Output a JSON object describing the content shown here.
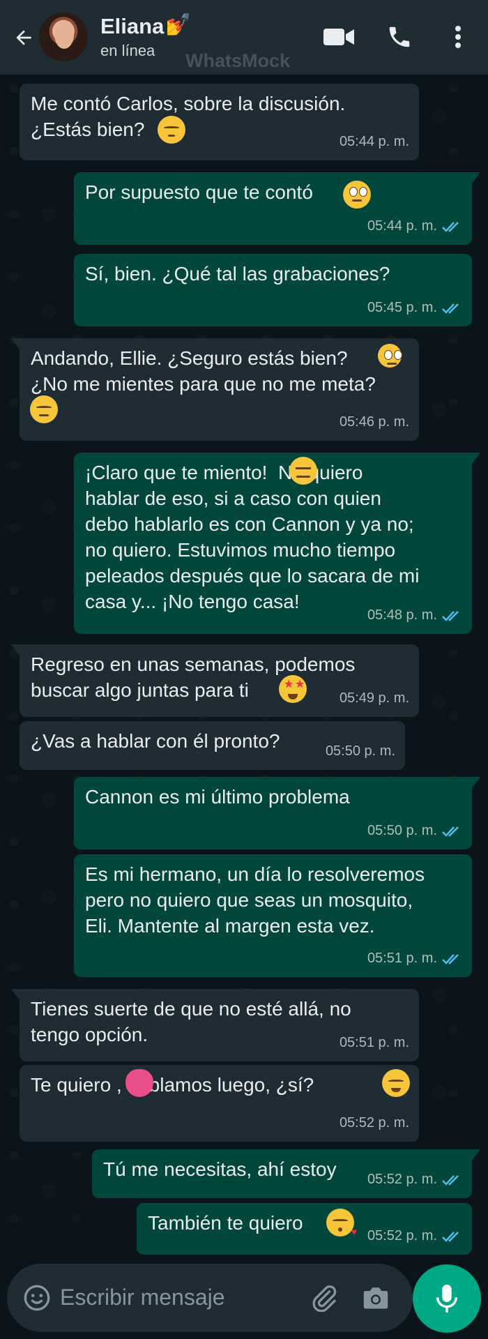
{
  "header": {
    "contact_name": "Eliana",
    "status": "en línea",
    "watermark": "WhatsMock",
    "name_emoji": "💅"
  },
  "messages": [
    {
      "dir": "in",
      "text": "Me contó Carlos, sobre la discusión.\n¿Estás bien?",
      "emoji": "pensive-face",
      "time": "05:44 p. m."
    },
    {
      "dir": "out",
      "text": "Por supuesto que te contó",
      "emoji": "eye-roll-face",
      "time": "05:44 p. m.",
      "read": true
    },
    {
      "dir": "out",
      "text": "Sí, bien. ¿Qué tal las grabaciones?",
      "time": "05:45 p. m.",
      "read": true
    },
    {
      "dir": "in",
      "text": "Andando, Ellie. ¿Seguro estás bien?\n¿No me mientes para que no me meta?",
      "emoji": "unamused-face",
      "time": "05:46 p. m."
    },
    {
      "dir": "out",
      "text": "¡Claro que te miento!  No quiero\nhablar de eso, si a caso con quien\ndebo hablarlo es con Cannon y ya no;\nno quiero. Estuvimos mucho tiempo\npeleados después que lo sacara de mi\ncasa y... ¡No tengo casa!",
      "emoji": "expressionless-face",
      "time": "05:48 p. m.",
      "read": true
    },
    {
      "dir": "in",
      "text": "Regreso en unas semanas, podemos\nbuscar algo juntas para ti",
      "emoji": "star-struck-face",
      "time": "05:49 p. m."
    },
    {
      "dir": "in",
      "text": "¿Vas a hablar con él pronto?",
      "time": "05:50 p. m."
    },
    {
      "dir": "out",
      "text": "Cannon es mi último problema",
      "time": "05:50 p. m.",
      "read": true
    },
    {
      "dir": "out",
      "text": "Es mi hermano, un día lo resolveremos\npero no quiero que seas un mosquito,\nEli. Mantente al margen esta vez.",
      "time": "05:51 p. m.",
      "read": true
    },
    {
      "dir": "in",
      "text": "Tienes suerte de que no esté allá, no\ntengo opción.",
      "time": "05:51 p. m."
    },
    {
      "dir": "in",
      "text": "Te quiero , hablamos luego, ¿sí?",
      "emoji": "smiling-face",
      "time": "05:52 p. m."
    },
    {
      "dir": "out",
      "text": "Tú me necesitas, ahí estoy",
      "time": "05:52 p. m.",
      "read": true
    },
    {
      "dir": "out",
      "text": "También te quiero",
      "emoji": "kissing-face",
      "time": "05:52 p. m.",
      "read": true
    }
  ],
  "input": {
    "placeholder": "Escribir mensaje"
  },
  "colors": {
    "header_bg": "#1f2c34",
    "incoming_bubble": "#1f2c34",
    "outgoing_bubble": "#03463b",
    "read_ticks": "#53bdeb",
    "mic_button": "#00a884"
  }
}
